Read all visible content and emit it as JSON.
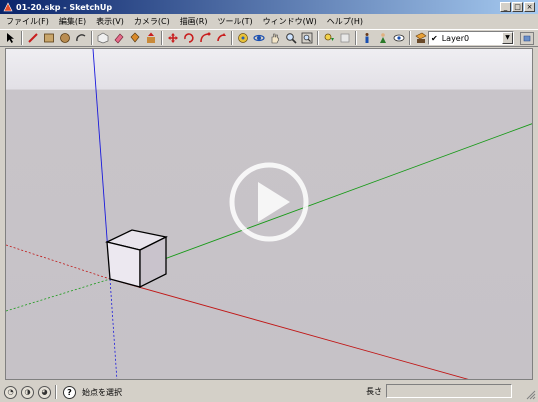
{
  "window": {
    "title": "01-20.skp - SketchUp",
    "controls": {
      "minimize": "_",
      "maximize": "□",
      "close": "×"
    }
  },
  "menubar": {
    "items": [
      "ファイル(F)",
      "編集(E)",
      "表示(V)",
      "カメラ(C)",
      "描画(R)",
      "ツール(T)",
      "ウィンドウ(W)",
      "ヘルプ(H)"
    ]
  },
  "toolbar": {
    "tools": [
      "select-icon",
      "pencil-icon",
      "rectangle-icon",
      "circle-icon",
      "arc-icon",
      "make-component-icon",
      "eraser-icon",
      "paint-bucket-icon",
      "push-pull-icon",
      "move-icon",
      "rotate-icon",
      "follow-me-icon",
      "scale-icon",
      "offset-icon",
      "tape-measure-icon",
      "orbit-icon",
      "pan-icon",
      "zoom-icon",
      "zoom-extents-icon",
      "previous-view-icon",
      "next-view-icon",
      "walk-icon",
      "position-camera-icon",
      "look-around-icon",
      "section-plane-icon",
      "text-icon",
      "dimension-icon",
      "axes-icon"
    ],
    "layer": {
      "check": "✔",
      "value": "Layer0",
      "arrow": "▼"
    }
  },
  "viewport": {
    "play_overlay": true,
    "axis_colors": {
      "red": "#c01818",
      "green": "#189a18",
      "blue": "#1a1adc"
    }
  },
  "statusbar": {
    "icons": [
      "geolocation-icon",
      "credits-icon",
      "user-icon"
    ],
    "help": "?",
    "message": "始点を選択",
    "measurements_label": "長さ"
  }
}
